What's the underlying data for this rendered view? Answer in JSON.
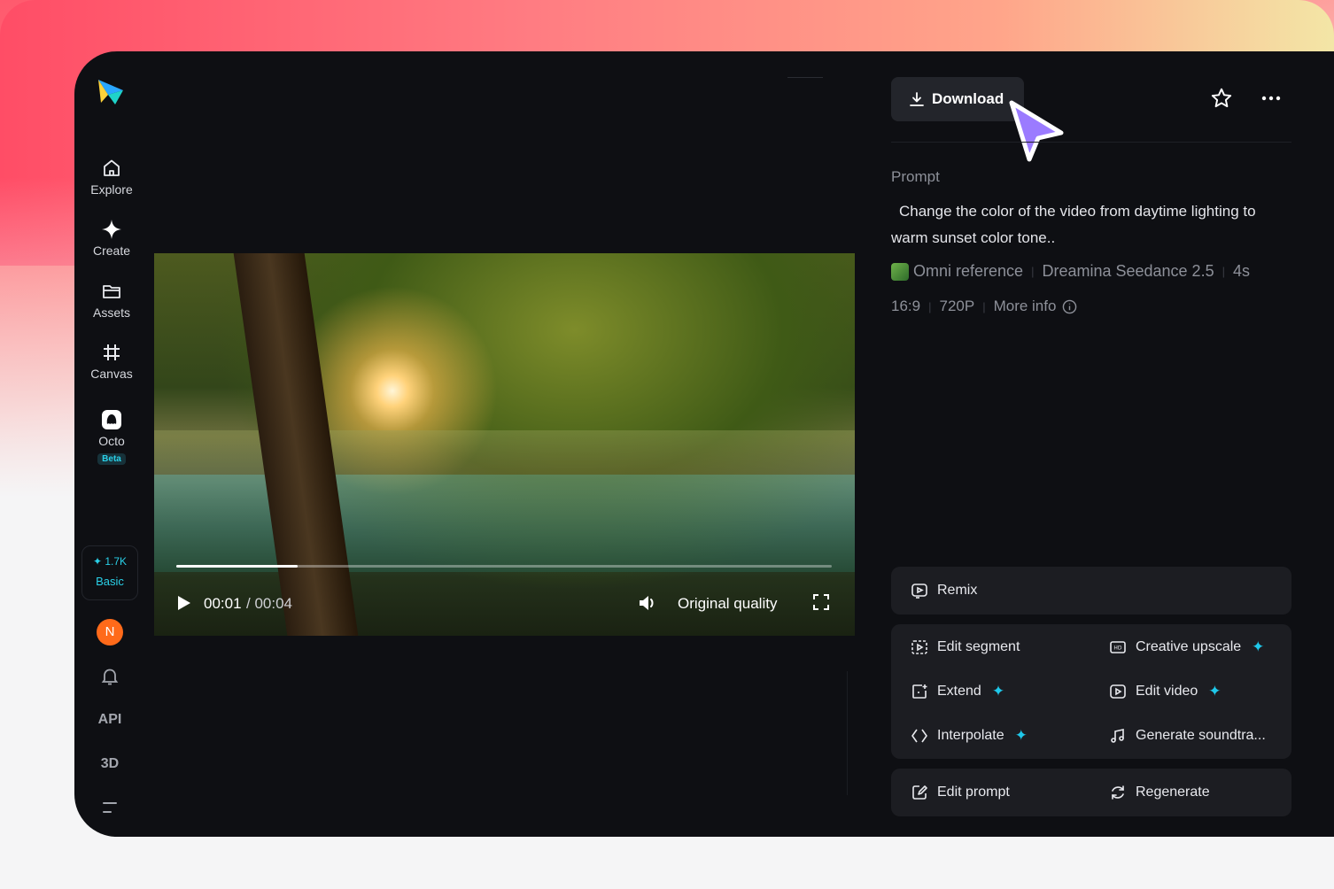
{
  "sidebar": {
    "items": [
      {
        "label": "Explore",
        "icon": "home-icon"
      },
      {
        "label": "Create",
        "icon": "sparkle-icon"
      },
      {
        "label": "Assets",
        "icon": "folder-icon"
      },
      {
        "label": "Canvas",
        "icon": "canvas-icon"
      },
      {
        "label": "Octo",
        "icon": "octo-icon",
        "badge": "Beta"
      }
    ],
    "credits": {
      "amount": "1.7K",
      "plan": "Basic"
    },
    "avatar_initial": "N",
    "api_label": "API",
    "threed_label": "3D"
  },
  "player": {
    "current_time": "00:01",
    "total_time": "/ 00:04",
    "progress": 0.185,
    "quality": "Original quality"
  },
  "panel": {
    "download_label": "Download",
    "prompt_label": "Prompt",
    "prompt_text": "Change the color of the video from daytime lighting to warm sunset color tone..",
    "meta": {
      "reference": "Omni reference",
      "model": "Dreamina Seedance 2.5",
      "duration": "4s",
      "ratio": "16:9",
      "resolution": "720P",
      "more_info": "More info"
    },
    "actions": {
      "remix": "Remix",
      "edit_segment": "Edit segment",
      "creative_upscale": "Creative upscale",
      "extend": "Extend",
      "edit_video": "Edit video",
      "interpolate": "Interpolate",
      "generate_soundtrack": "Generate soundtra...",
      "edit_prompt": "Edit prompt",
      "regenerate": "Regenerate"
    }
  },
  "colors": {
    "accent_cyan": "#1fc8ea",
    "app_bg": "#0e0f13",
    "card_bg": "#1c1d22",
    "cursor_purple": "#9b7bff"
  }
}
